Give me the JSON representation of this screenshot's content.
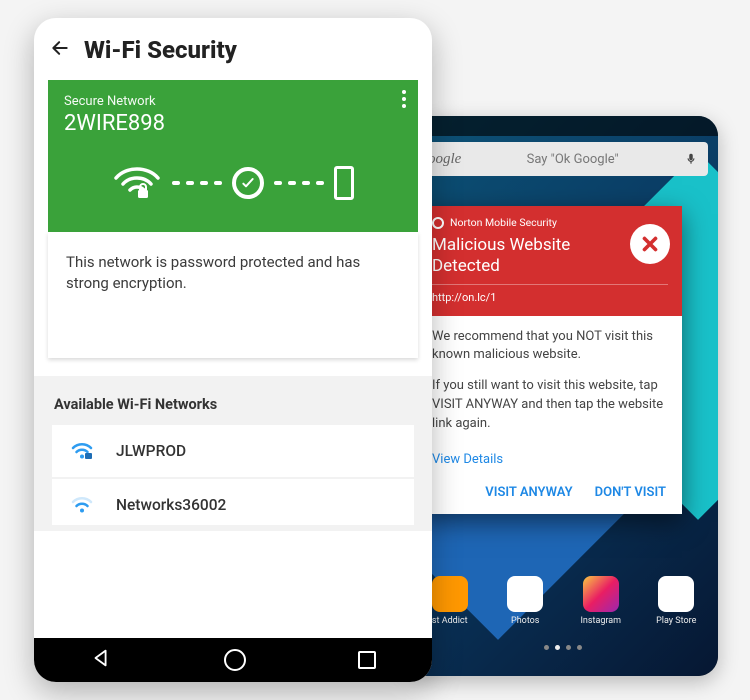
{
  "front": {
    "page_title": "Wi-Fi Security",
    "card": {
      "caption": "Secure Network",
      "ssid": "2WIRE898",
      "status_color": "#3aa23a"
    },
    "description": "This network is password protected and has strong encryption.",
    "available_header": "Available Wi-Fi Networks",
    "networks": [
      {
        "ssid": "JLWPROD"
      },
      {
        "ssid": "Networks36002"
      }
    ]
  },
  "back": {
    "search_logo": "oogle",
    "search_hint": "Say \"Ok Google\"",
    "app_labels": [
      "st Addict",
      "Photos",
      "Instagram",
      "Play Store"
    ],
    "dialog": {
      "brand": "Norton Mobile Security",
      "title": "Malicious Website Detected",
      "url": "http://on.lc/1",
      "body1": "We recommend that you NOT visit this known malicious website.",
      "body2": "If you still want to visit this website, tap VISIT ANYWAY and then tap the website link again.",
      "details_link": "View Details",
      "action_visit": "VISIT ANYWAY",
      "action_dont": "DON'T VISIT",
      "danger_color": "#d32f2f"
    }
  }
}
